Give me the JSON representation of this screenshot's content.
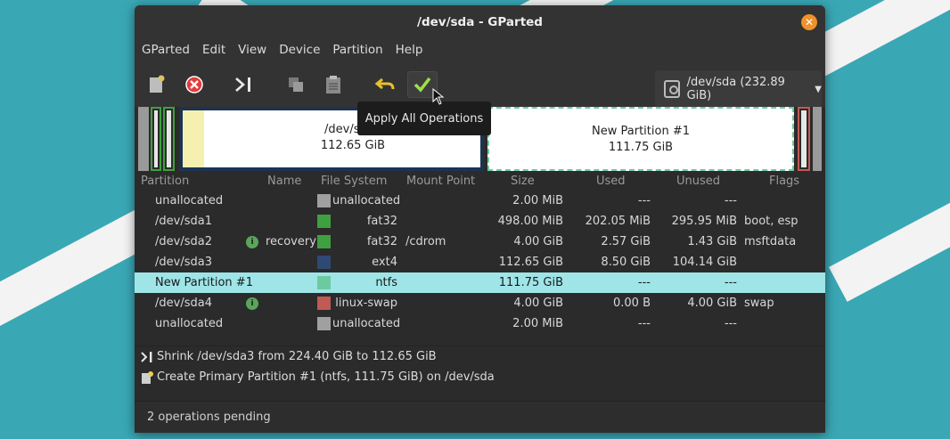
{
  "window": {
    "title": "/dev/sda - GParted"
  },
  "menu": [
    "GParted",
    "Edit",
    "View",
    "Device",
    "Partition",
    "Help"
  ],
  "toolbar": {
    "tooltip": "Apply All Operations",
    "device": "/dev/sda (232.89 GiB)"
  },
  "map": {
    "sda3_label": "/dev/sda3",
    "sda3_size": "112.65 GiB",
    "new_label": "New Partition #1",
    "new_size": "111.75 GiB"
  },
  "columns": {
    "partition": "Partition",
    "name": "Name",
    "fs": "File System",
    "mount": "Mount Point",
    "size": "Size",
    "used": "Used",
    "unused": "Unused",
    "flags": "Flags"
  },
  "rows": [
    {
      "partition": "unallocated",
      "name": "",
      "fs": "unallocated",
      "mount": "",
      "size": "2.00 MiB",
      "used": "---",
      "unused": "---",
      "flags": "",
      "color": "#a0a0a0"
    },
    {
      "partition": "/dev/sda1",
      "name": "",
      "fs": "fat32",
      "mount": "",
      "size": "498.00 MiB",
      "used": "202.05 MiB",
      "unused": "295.95 MiB",
      "flags": "boot, esp",
      "color": "#3fa03f"
    },
    {
      "partition": "/dev/sda2",
      "name": "recovery",
      "fs": "fat32",
      "mount": "/cdrom",
      "size": "4.00 GiB",
      "used": "2.57 GiB",
      "unused": "1.43 GiB",
      "flags": "msftdata",
      "color": "#3fa03f"
    },
    {
      "partition": "/dev/sda3",
      "name": "",
      "fs": "ext4",
      "mount": "",
      "size": "112.65 GiB",
      "used": "8.50 GiB",
      "unused": "104.14 GiB",
      "flags": "",
      "color": "#2e4a72"
    },
    {
      "partition": "New Partition #1",
      "name": "",
      "fs": "ntfs",
      "mount": "",
      "size": "111.75 GiB",
      "used": "---",
      "unused": "---",
      "flags": "",
      "color": "#6ccaa0"
    },
    {
      "partition": "/dev/sda4",
      "name": "",
      "fs": "linux-swap",
      "mount": "",
      "size": "4.00 GiB",
      "used": "0.00 B",
      "unused": "4.00 GiB",
      "flags": "swap",
      "color": "#c05a55"
    },
    {
      "partition": "unallocated",
      "name": "",
      "fs": "unallocated",
      "mount": "",
      "size": "2.00 MiB",
      "used": "---",
      "unused": "---",
      "flags": "",
      "color": "#a0a0a0"
    }
  ],
  "operations": [
    "Shrink /dev/sda3 from 224.40 GiB to 112.65 GiB",
    "Create Primary Partition #1 (ntfs, 111.75 GiB) on /dev/sda"
  ],
  "status": "2 operations pending"
}
